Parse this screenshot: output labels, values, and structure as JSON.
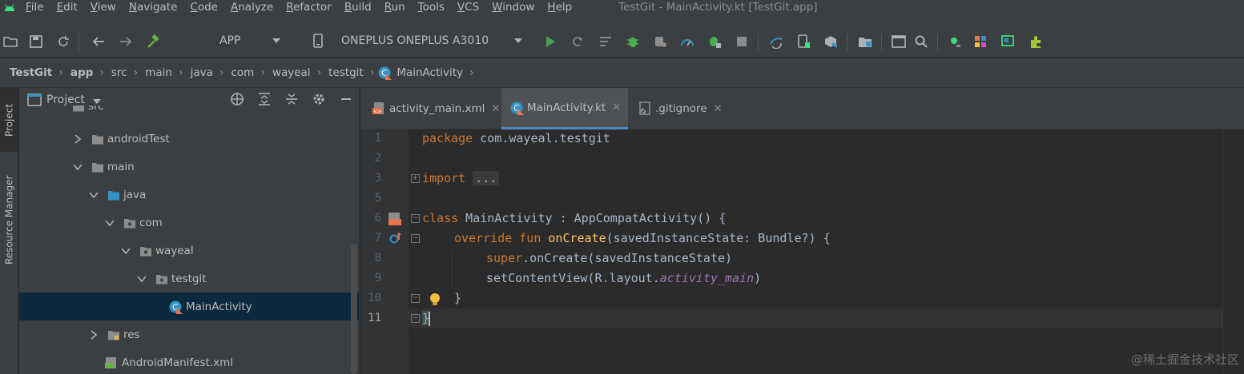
{
  "menu": {
    "items": [
      "File",
      "Edit",
      "View",
      "Navigate",
      "Code",
      "Analyze",
      "Refactor",
      "Build",
      "Run",
      "Tools",
      "VCS",
      "Window",
      "Help"
    ],
    "window_title": "TestGit - MainActivity.kt [TestGit.app]"
  },
  "toolbar": {
    "run_config": "APP",
    "device": "ONEPLUS ONEPLUS A3010",
    "icons": [
      "open-folder-icon",
      "save-icon",
      "sync-icon",
      "back-icon",
      "forward-icon",
      "hammer-icon",
      "android-icon",
      "dropdown-icon",
      "phone-icon",
      "dropdown-icon",
      "run-icon",
      "apply-changes-icon",
      "apply-code-changes-icon",
      "debug-icon",
      "attach-debugger-icon",
      "profile-icon",
      "debug-attach-icon",
      "stop-icon",
      "sync-gradle-icon",
      "device-manager-icon",
      "sdk-manager-icon",
      "project-structure-icon",
      "terminal-icon",
      "search-icon",
      "layout-inspector-icon",
      "resource-icon",
      "gradle-icon",
      "plugin-icon"
    ],
    "colors": {
      "run": "#499c54",
      "debug": "#4caf50",
      "stop": "#8c8c8c"
    }
  },
  "breadcrumb": [
    "TestGit",
    "app",
    "src",
    "main",
    "java",
    "com",
    "wayeal",
    "testgit",
    "MainActivity"
  ],
  "left_stripe": {
    "project_tab": "Project",
    "resource_tab": "Resource Manager"
  },
  "project_panel": {
    "title": "Project",
    "tree": [
      {
        "label": "src",
        "depth": 3,
        "expanded": true,
        "type": "folder"
      },
      {
        "label": "androidTest",
        "depth": 4,
        "expanded": false,
        "type": "folder"
      },
      {
        "label": "main",
        "depth": 4,
        "expanded": true,
        "type": "folder"
      },
      {
        "label": "java",
        "depth": 5,
        "expanded": true,
        "type": "source-folder"
      },
      {
        "label": "com",
        "depth": 6,
        "expanded": true,
        "type": "package"
      },
      {
        "label": "wayeal",
        "depth": 7,
        "expanded": true,
        "type": "package"
      },
      {
        "label": "testgit",
        "depth": 8,
        "expanded": true,
        "type": "package"
      },
      {
        "label": "MainActivity",
        "depth": 9,
        "expanded": null,
        "type": "kotlin-class",
        "selected": true
      },
      {
        "label": "res",
        "depth": 5,
        "expanded": false,
        "type": "res-folder"
      },
      {
        "label": "AndroidManifest.xml",
        "depth": 5,
        "expanded": null,
        "type": "manifest"
      }
    ]
  },
  "editor": {
    "tabs": [
      {
        "label": "activity_main.xml",
        "active": false,
        "icon": "xml-file-icon"
      },
      {
        "label": "MainActivity.kt",
        "active": true,
        "icon": "kotlin-class-icon"
      },
      {
        "label": ".gitignore",
        "active": false,
        "icon": "gitignore-file-icon"
      }
    ],
    "line_numbers": [
      "1",
      "2",
      "3",
      "5",
      "6",
      "7",
      "8",
      "9",
      "10",
      "11"
    ],
    "code": {
      "l1_kw": "package",
      "l1_rest": " com.wayeal.testgit",
      "l3_kw": "import",
      "l3_fold": "...",
      "l6_kw": "class",
      "l6_rest": " MainActivity : AppCompatActivity() {",
      "l7_kw": "override fun",
      "l7_fn": "onCreate",
      "l7_rest": "(savedInstanceState: Bundle?) {",
      "l8_kw": "super",
      "l8_rest": ".onCreate(savedInstanceState)",
      "l9_pre": "setContentView(R.layout.",
      "l9_it": "activity_main",
      "l9_post": ")",
      "l10": "}",
      "l11": "}"
    }
  },
  "watermark": "@稀土掘金技术社区"
}
